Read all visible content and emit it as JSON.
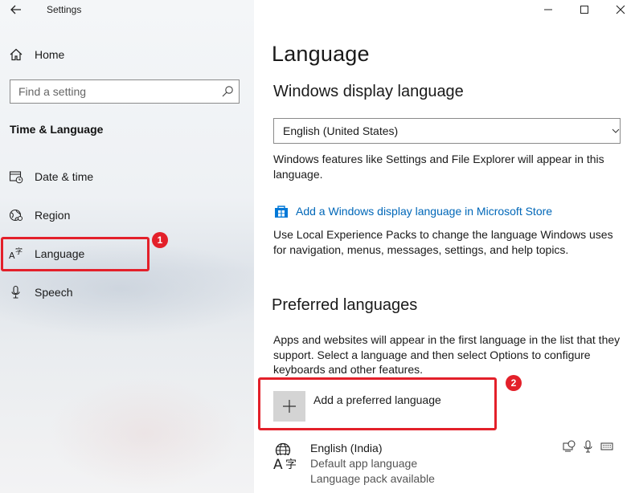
{
  "window": {
    "title": "Settings",
    "controls": {
      "minimize": "—",
      "maximize": "☐",
      "close": "✕"
    }
  },
  "sidebar": {
    "home_label": "Home",
    "search": {
      "placeholder": "Find a setting",
      "value": ""
    },
    "section_title": "Time & Language",
    "items": [
      {
        "label": "Date & time",
        "icon": "date-time-icon"
      },
      {
        "label": "Region",
        "icon": "region-icon"
      },
      {
        "label": "Language",
        "icon": "language-icon"
      },
      {
        "label": "Speech",
        "icon": "microphone-icon"
      }
    ]
  },
  "annotations": {
    "badge1": "1",
    "badge2": "2",
    "highlight_color": "#e3202a"
  },
  "main": {
    "title": "Language",
    "display_language": {
      "heading": "Windows display language",
      "selected": "English (United States)",
      "description": "Windows features like Settings and File Explorer will appear in this language.",
      "store_link": "Add a Windows display language in Microsoft Store",
      "lxp_description": "Use Local Experience Packs to change the language Windows uses for navigation, menus, messages, settings, and help topics."
    },
    "preferred": {
      "heading": "Preferred languages",
      "description": "Apps and websites will appear in the first language in the list that they support. Select a language and then select Options to configure keyboards and other features.",
      "add_label": "Add a preferred language",
      "languages": [
        {
          "name": "English (India)",
          "line1": "Default app language",
          "line2": "Language pack available",
          "features": [
            "display-language-icon",
            "speech-icon",
            "keyboard-icon"
          ]
        }
      ]
    }
  },
  "colors": {
    "accent_link": "#0067b8",
    "store_blue": "#0078d7"
  }
}
